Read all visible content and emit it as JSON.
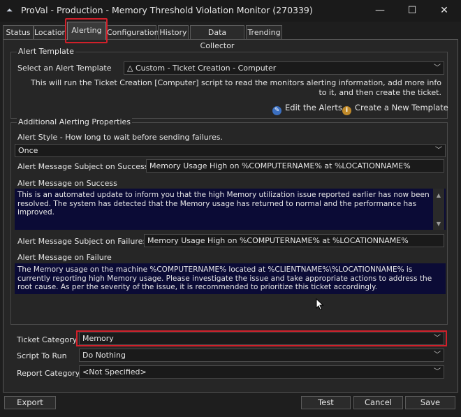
{
  "window": {
    "title": "ProVal - Production - Memory Threshold Violation Monitor (270339)",
    "minimize_icon": "—",
    "maximize_icon": "☐",
    "close_icon": "✕"
  },
  "tabs": [
    {
      "label": "Status"
    },
    {
      "label": "Location"
    },
    {
      "label": "Alerting"
    },
    {
      "label": "Configuration"
    },
    {
      "label": "History"
    },
    {
      "label": "Data Collector"
    },
    {
      "label": "Trending"
    }
  ],
  "alert_template": {
    "group_title": "Alert Template",
    "select_label": "Select an Alert Template",
    "selected": "△ Custom - Ticket Creation - Computer",
    "description": "This will run the Ticket Creation [Computer] script to read the monitors alerting information, add more info to it, and then create the ticket.",
    "edit_label": "Edit the Alerts",
    "create_label": "Create a New Template"
  },
  "additional": {
    "group_title": "Additional Alerting Properties",
    "style_label": "Alert Style - How long to wait before sending failures.",
    "style_value": "Once",
    "success_subject_label": "Alert Message Subject on Success:",
    "success_subject_value": "Memory Usage High on %COMPUTERNAME% at %LOCATIONNAME%",
    "success_message_label": "Alert Message on Success",
    "success_message_value": "This is an automated update to inform you that the high Memory utilization issue reported earlier has now been resolved. The system has detected that the Memory usage has returned to normal and the performance has improved.",
    "failure_subject_label": "Alert Message Subject on Failure:",
    "failure_subject_value": "Memory Usage High on %COMPUTERNAME% at %LOCATIONNAME%",
    "failure_message_label": "Alert Message on Failure",
    "failure_message_value": "The Memory usage on the machine %COMPUTERNAME% located at %CLIENTNAME%\\%LOCATIONNAME% is currently reporting high Memory usage. Please investigate the issue and take appropriate actions to address the root cause. As per the severity of the issue, it is recommended to prioritize this ticket accordingly."
  },
  "ticket": {
    "category_label": "Ticket Category",
    "category_value": "Memory",
    "script_label": "Script To Run",
    "script_value": "Do Nothing",
    "report_label": "Report Category",
    "report_value": "<Not Specified>"
  },
  "buttons": {
    "export": "Export",
    "test": "Test",
    "cancel": "Cancel",
    "save": "Save"
  },
  "colors": {
    "highlight": "#d1202a",
    "memo_background": "#0b0b36"
  }
}
